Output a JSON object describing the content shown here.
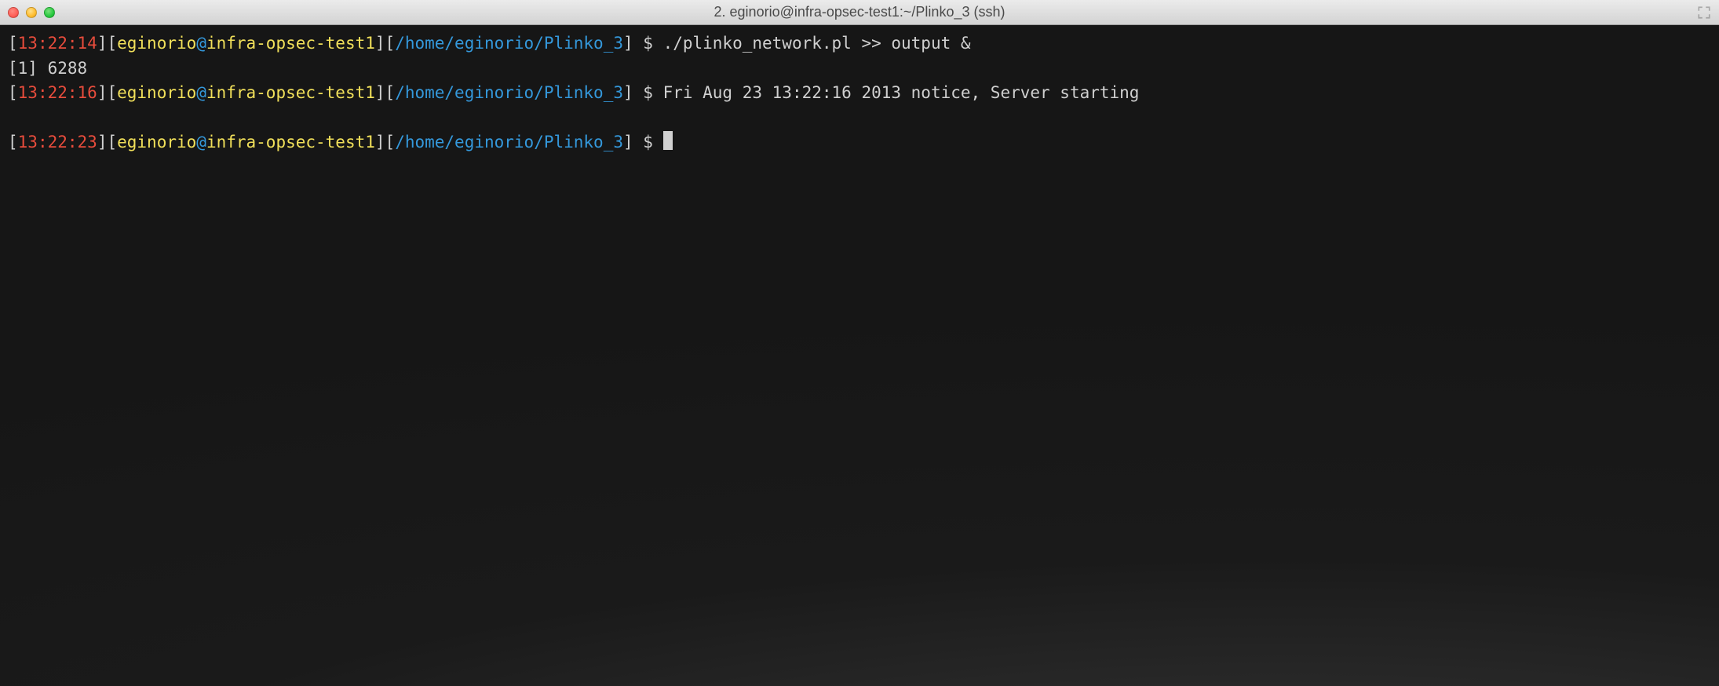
{
  "window": {
    "title": "2. eginorio@infra-opsec-test1:~/Plinko_3 (ssh)"
  },
  "lines": [
    {
      "type": "prompt",
      "time": "13:22:14",
      "user": "eginorio",
      "host": "infra-opsec-test1",
      "path": "/home/eginorio/Plinko_3",
      "command": "./plinko_network.pl >> output &"
    },
    {
      "type": "output",
      "text": "[1] 6288"
    },
    {
      "type": "prompt",
      "time": "13:22:16",
      "user": "eginorio",
      "host": "infra-opsec-test1",
      "path": "/home/eginorio/Plinko_3",
      "command": "Fri Aug 23 13:22:16 2013 notice, Server starting"
    },
    {
      "type": "blank"
    },
    {
      "type": "prompt",
      "time": "13:22:23",
      "user": "eginorio",
      "host": "infra-opsec-test1",
      "path": "/home/eginorio/Plinko_3",
      "command": "",
      "cursor": true
    }
  ]
}
